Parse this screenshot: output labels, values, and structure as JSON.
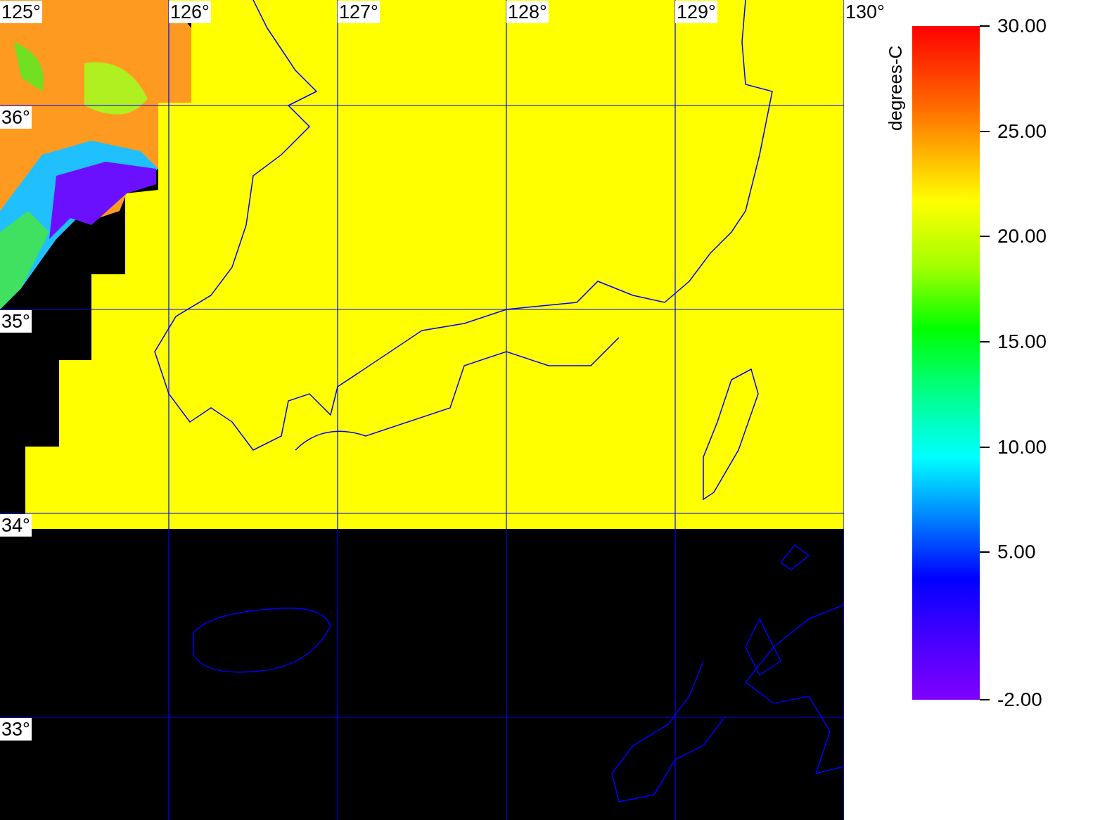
{
  "map": {
    "longitudes": [
      "125°",
      "126°",
      "127°",
      "128°",
      "129°",
      "130°"
    ],
    "latitudes": [
      "36°",
      "35°",
      "34°",
      "33°"
    ]
  },
  "colorbar": {
    "title": "degrees-C",
    "ticks": [
      "30.00",
      "25.00",
      "20.00",
      "15.00",
      "10.00",
      "5.00",
      "-2.00"
    ]
  }
}
